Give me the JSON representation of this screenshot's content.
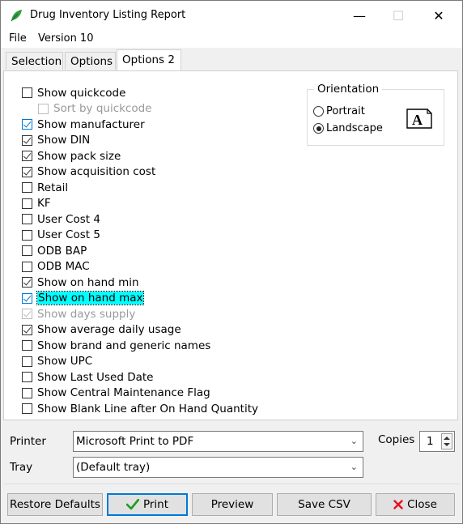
{
  "window": {
    "title": "Drug Inventory Listing Report",
    "minimize": "—",
    "maximize": "☐",
    "close": "✕"
  },
  "menu": [
    {
      "label": "File"
    },
    {
      "label": "Version 10"
    }
  ],
  "tabs": [
    {
      "label": "Selection"
    },
    {
      "label": "Options"
    },
    {
      "label": "Options 2",
      "active": true
    }
  ],
  "options": [
    {
      "label": "Show quickcode",
      "checked": false
    },
    {
      "label": "Sort by quickcode",
      "checked": false,
      "disabled": true,
      "indent": true
    },
    {
      "label": "Show manufacturer",
      "checked": true,
      "blue": true
    },
    {
      "label": "Show DIN",
      "checked": true
    },
    {
      "label": "Show pack size",
      "checked": true
    },
    {
      "label": "Show acquisition cost",
      "checked": true
    },
    {
      "label": "Retail",
      "checked": false
    },
    {
      "label": "KF",
      "checked": false
    },
    {
      "label": "User Cost 4",
      "checked": false
    },
    {
      "label": "User Cost 5",
      "checked": false
    },
    {
      "label": "ODB BAP",
      "checked": false
    },
    {
      "label": "ODB MAC",
      "checked": false
    },
    {
      "label": "Show on hand min",
      "checked": true
    },
    {
      "label": "Show on hand max",
      "checked": true,
      "focused": true,
      "blue": true
    },
    {
      "label": "Show days supply",
      "checked": true,
      "disabled": true
    },
    {
      "label": "Show average daily usage",
      "checked": true
    },
    {
      "label": "Show brand and generic names",
      "checked": false
    },
    {
      "label": "Show UPC",
      "checked": false
    },
    {
      "label": "Show Last Used Date",
      "checked": false
    },
    {
      "label": "Show Central Maintenance Flag",
      "checked": false
    },
    {
      "label": "Show Blank Line after On Hand Quantity",
      "checked": false
    }
  ],
  "orientation": {
    "title": "Orientation",
    "options": [
      {
        "label": "Portrait",
        "selected": false
      },
      {
        "label": "Landscape",
        "selected": true
      }
    ],
    "icon": "landscape-page-icon",
    "icon_letter": "A"
  },
  "printer": {
    "label": "Printer",
    "value": "Microsoft Print to PDF"
  },
  "tray": {
    "label": "Tray",
    "value": "(Default tray)"
  },
  "copies": {
    "label": "Copies",
    "value": "1"
  },
  "buttons": {
    "restore": "Restore Defaults",
    "print": "Print",
    "preview": "Preview",
    "save_csv": "Save CSV",
    "close": "Close"
  },
  "colors": {
    "accent": "#0078d7",
    "focus_highlight": "#00ffff",
    "leaf_green": "#2e9e3e",
    "close_red": "#e81123",
    "print_check": "#1e9b1e"
  }
}
